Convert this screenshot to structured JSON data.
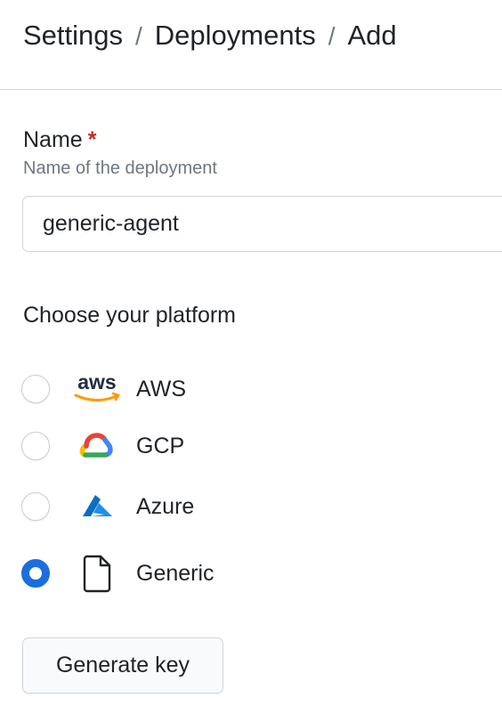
{
  "breadcrumb": {
    "items": [
      "Settings",
      "Deployments",
      "Add"
    ],
    "separator": "/"
  },
  "form": {
    "name": {
      "label": "Name",
      "required_mark": "*",
      "help": "Name of the deployment",
      "value": "generic-agent"
    },
    "platform": {
      "title": "Choose your platform",
      "selected": "Generic",
      "options": [
        {
          "label": "AWS",
          "icon": "aws-logo-icon",
          "checked": false
        },
        {
          "label": "GCP",
          "icon": "gcp-cloud-icon",
          "checked": false
        },
        {
          "label": "Azure",
          "icon": "azure-logo-icon",
          "checked": false
        },
        {
          "label": "Generic",
          "icon": "file-icon",
          "checked": true
        }
      ]
    },
    "generate_button_label": "Generate key"
  },
  "aws_logo_text": "aws",
  "colors": {
    "accent": "#1a6fdc",
    "required": "#c22a2a",
    "muted_text": "#6e7781",
    "border": "#d0d7de",
    "aws_orange": "#ff9900",
    "azure_blue": "#0a6fc2"
  }
}
